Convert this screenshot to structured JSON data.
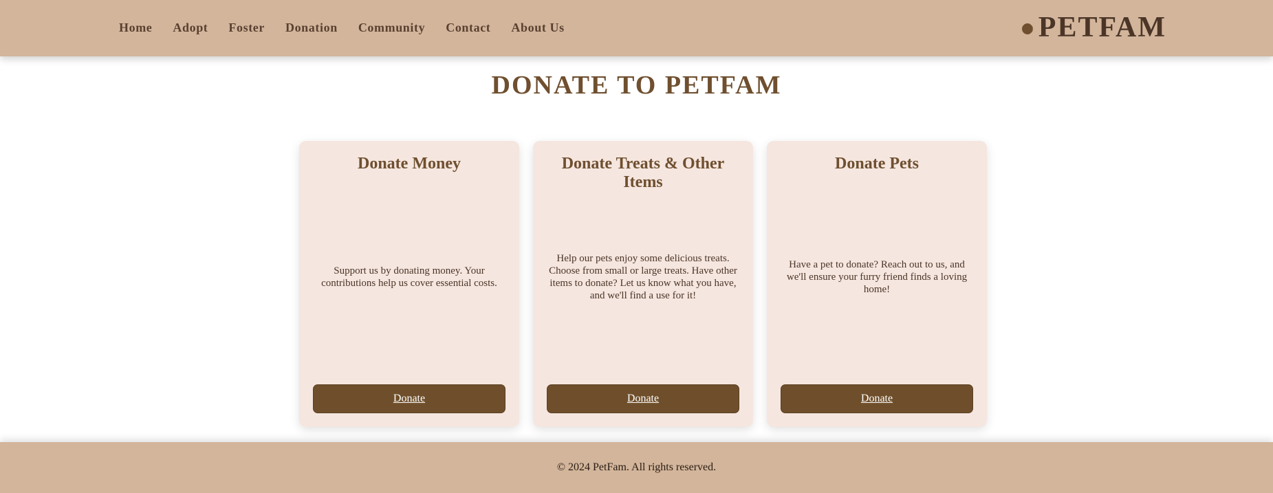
{
  "header": {
    "nav": [
      {
        "label": "Home"
      },
      {
        "label": "Adopt"
      },
      {
        "label": "Foster"
      },
      {
        "label": "Donation"
      },
      {
        "label": "Community"
      },
      {
        "label": "Contact"
      },
      {
        "label": "About Us"
      }
    ],
    "logo": {
      "text": "PETFAM",
      "icon": "paw-dot-icon"
    }
  },
  "main": {
    "title": "DONATE TO PETFAM",
    "cards": [
      {
        "title": "Donate Money",
        "description": "Support us by donating money. Your contributions help us cover essential costs.",
        "button_label": "Donate"
      },
      {
        "title": "Donate Treats & Other Items",
        "description": "Help our pets enjoy some delicious treats. Choose from small or large treats. Have other items to donate? Let us know what you have, and we'll find a use for it!",
        "button_label": "Donate"
      },
      {
        "title": "Donate Pets",
        "description": "Have a pet to donate? Reach out to us, and we'll ensure your furry friend finds a loving home!",
        "button_label": "Donate"
      }
    ]
  },
  "footer": {
    "copyright": "© 2024 PetFam. All rights reserved."
  },
  "colors": {
    "header_bg": "#d2b59b",
    "accent_brown": "#6f4f2b",
    "card_bg": "#f5e6df",
    "text_dark": "#4b3527"
  }
}
